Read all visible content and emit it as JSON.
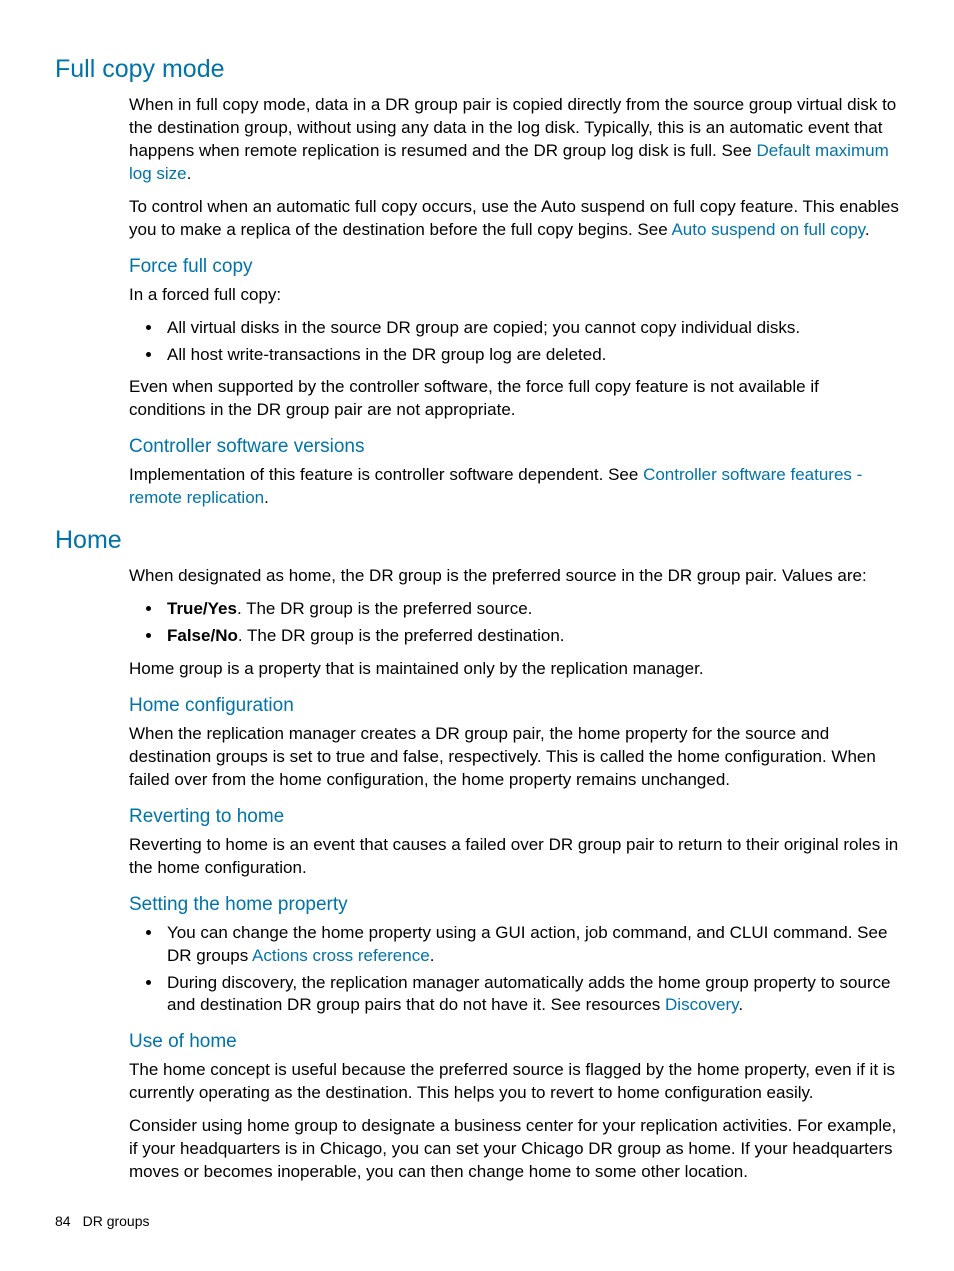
{
  "section1": {
    "title": "Full copy mode",
    "p1a": "When in full copy mode, data in a DR group pair is copied directly from the source group virtual disk to the destination group, without using any data in the log disk. Typically, this is an automatic event that happens when remote replication is resumed and the DR group log disk is full. See ",
    "link1": "Default maximum log size",
    "p1b": ".",
    "p2a": "To control when an automatic full copy occurs, use the Auto suspend on full copy feature. This enables you to make a replica of the destination before the full copy begins. See ",
    "link2": "Auto suspend on full copy",
    "p2b": ".",
    "sub1": {
      "title": "Force full copy",
      "intro": "In a forced full copy:",
      "li1": "All virtual disks in the source DR group are copied; you cannot copy individual disks.",
      "li2": "All host write-transactions in the DR group log are deleted.",
      "outro": "Even when supported by the controller software, the force full copy feature is not available if conditions in the DR group pair are not appropriate."
    },
    "sub2": {
      "title": "Controller software versions",
      "p1a": "Implementation of this feature is controller software dependent. See ",
      "link1": "Controller software features - remote replication",
      "p1b": "."
    }
  },
  "section2": {
    "title": "Home",
    "p1": "When designated as home, the DR group is the preferred source in the DR group pair. Values are:",
    "li1bold": "True/Yes",
    "li1text": ". The DR group is the preferred source.",
    "li2bold": "False/No",
    "li2text": ". The DR group is the preferred destination.",
    "p2": "Home group is a property that is maintained only by the replication manager.",
    "sub1": {
      "title": "Home configuration",
      "p1": "When the replication manager creates a DR group pair, the home property for the source and destination groups is set to true and false, respectively. This is called the home configuration. When failed over from the home configuration, the home property remains unchanged."
    },
    "sub2": {
      "title": "Reverting to home",
      "p1": "Reverting to home is an event that causes a failed over DR group pair to return to their original roles in the home configuration."
    },
    "sub3": {
      "title": "Setting the home property",
      "li1a": "You can change the home property using a GUI action, job command, and CLUI command. See DR groups ",
      "li1link": "Actions cross reference",
      "li1b": ".",
      "li2a": "During discovery, the replication manager automatically adds the home group property to source and destination DR group pairs that do not have it. See resources ",
      "li2link": "Discovery",
      "li2b": "."
    },
    "sub4": {
      "title": "Use of home",
      "p1": "The home concept is useful because the preferred source is flagged by the home property, even if it is currently operating as the destination. This helps you to revert to home configuration easily.",
      "p2": "Consider using home group to designate a business center for your replication activities. For example, if your headquarters is in Chicago, you can set your Chicago DR group as home. If your headquarters moves or becomes inoperable, you can then change home to some other location."
    }
  },
  "footer": {
    "page": "84",
    "chapter": "DR groups"
  }
}
